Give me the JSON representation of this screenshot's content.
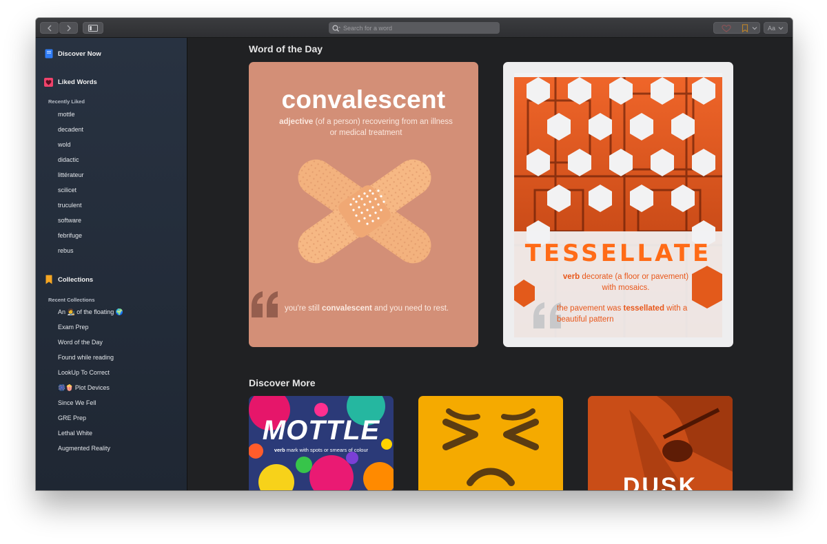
{
  "toolbar": {
    "search_placeholder": "Search for a word",
    "font_button": "Aa"
  },
  "sidebar": {
    "discover": "Discover Now",
    "liked": "Liked Words",
    "recently_liked_header": "Recently Liked",
    "recently_liked": [
      "mottle",
      "decadent",
      "wold",
      "didactic",
      "littérateur",
      "scilicet",
      "truculent",
      "software",
      "febrifuge",
      "rebus"
    ],
    "collections": "Collections",
    "recent_collections_header": "Recent Collections",
    "recent_collections": [
      "An 🧑‍🎨 of the floating 🌍",
      "Exam Prep",
      "Word of the Day",
      "Found while reading",
      "LookUp To Correct",
      "🎆🍿 Plot Devices",
      "Since We Fell",
      "GRE Prep",
      "Lethal White",
      "Augmented Reality"
    ]
  },
  "main": {
    "word_of_the_day_title": "Word of the Day",
    "discover_more_title": "Discover More",
    "card1": {
      "word": "convalescent",
      "pos": "adjective",
      "definition": " (of a person) recovering from an illness or medical treatment",
      "example_pre": "you're still ",
      "example_word": "convalescent",
      "example_post": " and you need to rest."
    },
    "card2": {
      "word": "TESSELLATE",
      "pos": "verb",
      "definition": " decorate (a floor or pavement) with mosaics.",
      "example_pre": "the pavement was ",
      "example_word": "tessellated",
      "example_post": " with a beautiful pattern"
    },
    "discover": {
      "card1_word": "MOTTLE",
      "card1_pos": "verb",
      "card1_def": " mark with spots or smears of colour",
      "card3_word": "DUSK"
    }
  },
  "colors": {
    "sidebar": "#283241",
    "card1_bg": "#d38f77",
    "tessellate_orange": "#ff6b17",
    "liked_icon": "#f0436b",
    "discover_icon": "#2f7cf6",
    "collections_icon": "#f5a623"
  },
  "icons": [
    "back-icon",
    "forward-icon",
    "sidebar-toggle-icon",
    "search-icon",
    "heart-icon",
    "bookmark-icon",
    "chevron-down-icon",
    "book-icon",
    "quote-icon"
  ]
}
